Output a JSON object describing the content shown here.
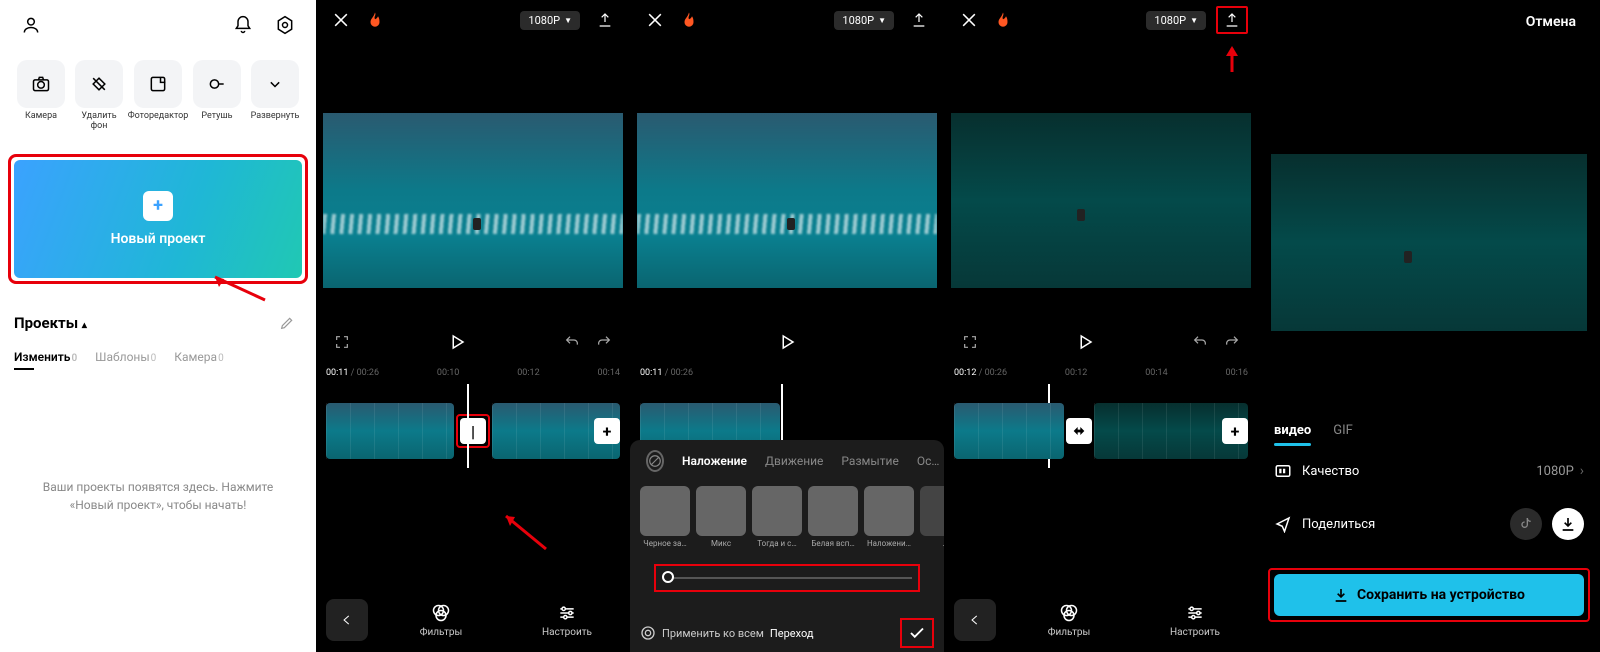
{
  "panel1": {
    "tools": [
      {
        "label": "Камера"
      },
      {
        "label": "Удалить фон"
      },
      {
        "label": "Фоторедактор"
      },
      {
        "label": "Ретушь"
      },
      {
        "label": "Развернуть"
      }
    ],
    "new_project_label": "Новый проект",
    "projects_heading": "Проекты",
    "tabs": {
      "edit": "Изменить",
      "edit_count": "0",
      "templates": "Шаблоны",
      "templates_count": "0",
      "camera": "Камера",
      "camera_count": "0"
    },
    "empty_text": "Ваши проекты появятся здесь. Нажмите «Новый проект», чтобы начать!"
  },
  "editor": {
    "resolution": "1080P",
    "ticks2": {
      "time": "00:11",
      "dur": "00:26",
      "t1": "00:10",
      "t2": "00:12",
      "t3": "00:14"
    },
    "ticks3": {
      "time": "00:11",
      "dur": "00:26"
    },
    "ticks4": {
      "time": "00:12",
      "dur": "00:26",
      "t1": "00:12",
      "t2": "00:14",
      "t3": "00:16"
    },
    "bottom": {
      "filters": "Фильтры",
      "adjust": "Настроить"
    }
  },
  "overlay": {
    "tabs": {
      "t1": "Наложение",
      "t2": "Движение",
      "t3": "Размытие",
      "t4": "Ос…"
    },
    "thumbs": [
      {
        "label": "Черное за…"
      },
      {
        "label": "Микс"
      },
      {
        "label": "Тогда и с…"
      },
      {
        "label": "Белая всп…"
      },
      {
        "label": "Наложени…"
      },
      {
        "label": "…"
      }
    ],
    "apply_all": "Применить ко всем",
    "transition_label": "Переход"
  },
  "panel5": {
    "cancel": "Отмена",
    "tabs": {
      "video": "видео",
      "gif": "GIF"
    },
    "quality_label": "Качество",
    "quality_value": "1080P",
    "share_label": "Поделиться",
    "save_label": "Сохранить на устройство"
  }
}
